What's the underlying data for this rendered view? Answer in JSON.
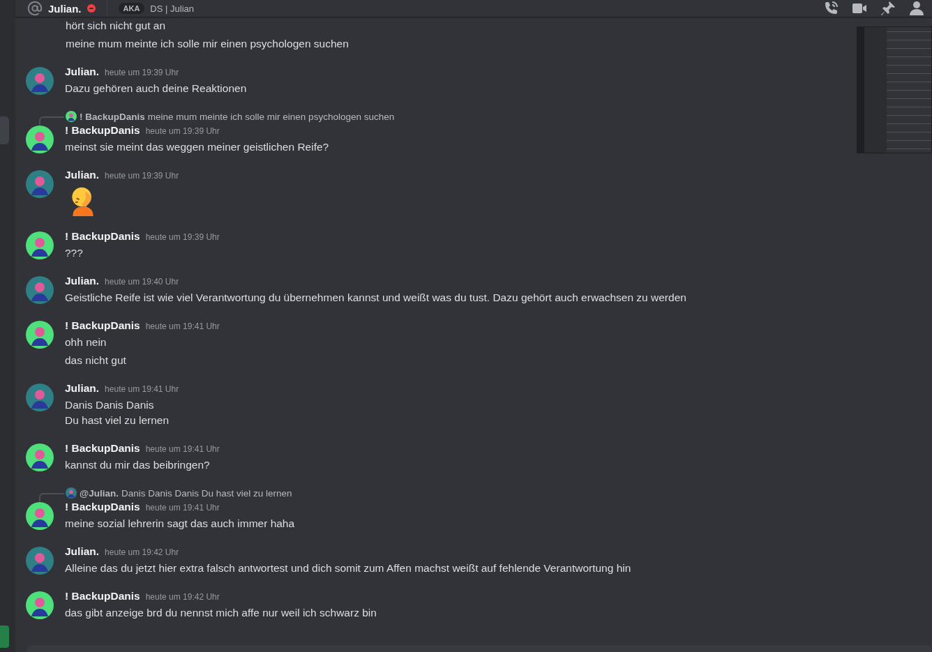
{
  "header": {
    "title": "Julian.",
    "do_not_disturb": true,
    "tag": "AKA",
    "subtitle": "DS | Julian"
  },
  "messages": [
    {
      "kind": "continuation",
      "lines": [
        "hört sich nicht gut an",
        "meine mum meinte ich solle mir einen psychologen suchen"
      ]
    },
    {
      "kind": "group",
      "author": "Julian.",
      "color": "#2f7f86",
      "time": "heute um 19:39 Uhr",
      "lines": [
        "Dazu gehören auch deine Reaktionen"
      ]
    },
    {
      "kind": "group",
      "author": "! BackupDanis",
      "color": "#4ee07a",
      "time": "heute um 19:39 Uhr",
      "reply": {
        "author": "! BackupDanis",
        "color": "#4ee07a",
        "text": "meine mum meinte ich solle mir einen psychologen suchen"
      },
      "lines": [
        "meinst sie meint das weggen meiner geistlichen Reife?"
      ]
    },
    {
      "kind": "group",
      "author": "Julian.",
      "color": "#2f7f86",
      "time": "heute um 19:39 Uhr",
      "jumbo_emoji": true
    },
    {
      "kind": "group",
      "author": "! BackupDanis",
      "color": "#4ee07a",
      "time": "heute um 19:39 Uhr",
      "lines": [
        "???"
      ]
    },
    {
      "kind": "group",
      "author": "Julian.",
      "color": "#2f7f86",
      "time": "heute um 19:40 Uhr",
      "lines": [
        "Geistliche Reife ist wie viel Verantwortung du übernehmen kannst und weißt was du tust. Dazu gehört auch erwachsen zu werden"
      ]
    },
    {
      "kind": "group",
      "author": "! BackupDanis",
      "color": "#4ee07a",
      "time": "heute um 19:41 Uhr",
      "lines": [
        "ohh nein",
        "das nicht gut"
      ]
    },
    {
      "kind": "group",
      "author": "Julian.",
      "color": "#2f7f86",
      "time": "heute um 19:41 Uhr",
      "lines": [
        "Danis Danis Danis\nDu hast viel zu lernen"
      ]
    },
    {
      "kind": "group",
      "author": "! BackupDanis",
      "color": "#4ee07a",
      "time": "heute um 19:41 Uhr",
      "lines": [
        "kannst du mir das beibringen?"
      ]
    },
    {
      "kind": "group",
      "author": "! BackupDanis",
      "color": "#4ee07a",
      "time": "heute um 19:41 Uhr",
      "reply": {
        "author": "@Julian.",
        "color": "#2f7f86",
        "text": "Danis Danis Danis Du hast viel zu lernen"
      },
      "lines": [
        "meine sozial lehrerin sagt das auch immer haha"
      ]
    },
    {
      "kind": "group",
      "author": "Julian.",
      "color": "#2f7f86",
      "time": "heute um 19:42 Uhr",
      "lines": [
        "Alleine das du jetzt hier extra falsch antwortest und dich somit zum Affen machst weißt auf fehlende Verantwortung hin"
      ]
    },
    {
      "kind": "group",
      "author": "! BackupDanis",
      "color": "#4ee07a",
      "time": "heute um 19:42 Uhr",
      "lines": [
        "das gibt anzeige brd du nennst mich affe nur weil ich schwarz bin"
      ]
    }
  ]
}
